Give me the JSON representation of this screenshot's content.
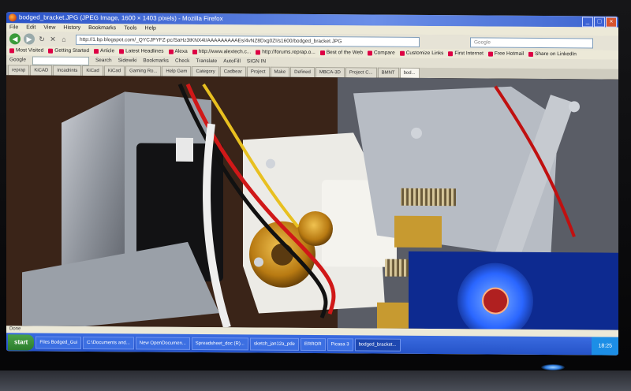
{
  "window": {
    "title": "bodged_bracket.JPG (JPEG Image, 1600 × 1403 pixels) - Mozilla Firefox"
  },
  "menu": [
    "File",
    "Edit",
    "View",
    "History",
    "Bookmarks",
    "Tools",
    "Help"
  ],
  "nav": {
    "url": "http://1.bp.blogspot.com/_QYCJPYFZ-pc/SaHz3tKNX4I/AAAAAAAAAEs/4vNZ8Dxg0ZI/s1600/bodged_bracket.JPG",
    "search_placeholder": "Google"
  },
  "bookmarks": [
    "Most Visited",
    "Getting Started",
    "Article",
    "Latest Headlines",
    "Alexa",
    "http://www.alextech.c...",
    "http://forums.reprap.o...",
    "Best of the Web",
    "Compare",
    "Customize Links",
    "First Internet",
    "Free Hotmail",
    "Share on LinkedIn"
  ],
  "googlebar": [
    "Google",
    "Search",
    "Sidewiki",
    "Bookmarks",
    "Check",
    "Translate",
    "AutoFill",
    "SIGN IN"
  ],
  "tabs": [
    "reprap",
    "KiCAD",
    "Incadrints",
    "KiCad",
    "KiCad",
    "Gaming Ro...",
    "Help Gem",
    "Category",
    "Cadbear",
    "Project",
    "Make",
    "Defined",
    "MBCA-3D",
    "Project C...",
    "BMNT",
    "bod..."
  ],
  "status": "Done",
  "taskbar": {
    "start": "start",
    "tasks": [
      "Files Bodged_Gui",
      "C:\\Documents and...",
      "New OpenDocumen...",
      "Spreadsheet_doc (R)...",
      "sketch_jan12a_pde",
      "ERROR",
      "Picasa 3",
      "bodged_bracket..."
    ],
    "clock": "18:25"
  },
  "colors": {
    "titlebar": "#2a53c8",
    "taskbar": "#2553c8",
    "fan_blue": "#2a66ff",
    "gear_brass": "#c9921c",
    "wire_red": "#d01818",
    "led_blue": "#2f7de0"
  }
}
